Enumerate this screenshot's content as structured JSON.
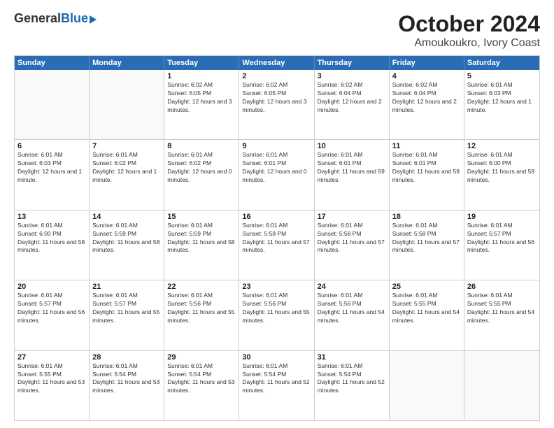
{
  "logo": {
    "general": "General",
    "blue": "Blue"
  },
  "title": "October 2024",
  "location": "Amoukoukro, Ivory Coast",
  "header": {
    "days": [
      "Sunday",
      "Monday",
      "Tuesday",
      "Wednesday",
      "Thursday",
      "Friday",
      "Saturday"
    ]
  },
  "weeks": [
    [
      {
        "day": "",
        "info": ""
      },
      {
        "day": "",
        "info": ""
      },
      {
        "day": "1",
        "info": "Sunrise: 6:02 AM\nSunset: 6:05 PM\nDaylight: 12 hours and 3 minutes."
      },
      {
        "day": "2",
        "info": "Sunrise: 6:02 AM\nSunset: 6:05 PM\nDaylight: 12 hours and 3 minutes."
      },
      {
        "day": "3",
        "info": "Sunrise: 6:02 AM\nSunset: 6:04 PM\nDaylight: 12 hours and 2 minutes."
      },
      {
        "day": "4",
        "info": "Sunrise: 6:02 AM\nSunset: 6:04 PM\nDaylight: 12 hours and 2 minutes."
      },
      {
        "day": "5",
        "info": "Sunrise: 6:01 AM\nSunset: 6:03 PM\nDaylight: 12 hours and 1 minute."
      }
    ],
    [
      {
        "day": "6",
        "info": "Sunrise: 6:01 AM\nSunset: 6:03 PM\nDaylight: 12 hours and 1 minute."
      },
      {
        "day": "7",
        "info": "Sunrise: 6:01 AM\nSunset: 6:02 PM\nDaylight: 12 hours and 1 minute."
      },
      {
        "day": "8",
        "info": "Sunrise: 6:01 AM\nSunset: 6:02 PM\nDaylight: 12 hours and 0 minutes."
      },
      {
        "day": "9",
        "info": "Sunrise: 6:01 AM\nSunset: 6:01 PM\nDaylight: 12 hours and 0 minutes."
      },
      {
        "day": "10",
        "info": "Sunrise: 6:01 AM\nSunset: 6:01 PM\nDaylight: 11 hours and 59 minutes."
      },
      {
        "day": "11",
        "info": "Sunrise: 6:01 AM\nSunset: 6:01 PM\nDaylight: 11 hours and 59 minutes."
      },
      {
        "day": "12",
        "info": "Sunrise: 6:01 AM\nSunset: 6:00 PM\nDaylight: 11 hours and 59 minutes."
      }
    ],
    [
      {
        "day": "13",
        "info": "Sunrise: 6:01 AM\nSunset: 6:00 PM\nDaylight: 11 hours and 58 minutes."
      },
      {
        "day": "14",
        "info": "Sunrise: 6:01 AM\nSunset: 5:59 PM\nDaylight: 11 hours and 58 minutes."
      },
      {
        "day": "15",
        "info": "Sunrise: 6:01 AM\nSunset: 5:59 PM\nDaylight: 11 hours and 58 minutes."
      },
      {
        "day": "16",
        "info": "Sunrise: 6:01 AM\nSunset: 5:58 PM\nDaylight: 11 hours and 57 minutes."
      },
      {
        "day": "17",
        "info": "Sunrise: 6:01 AM\nSunset: 5:58 PM\nDaylight: 11 hours and 57 minutes."
      },
      {
        "day": "18",
        "info": "Sunrise: 6:01 AM\nSunset: 5:58 PM\nDaylight: 11 hours and 57 minutes."
      },
      {
        "day": "19",
        "info": "Sunrise: 6:01 AM\nSunset: 5:57 PM\nDaylight: 11 hours and 56 minutes."
      }
    ],
    [
      {
        "day": "20",
        "info": "Sunrise: 6:01 AM\nSunset: 5:57 PM\nDaylight: 11 hours and 56 minutes."
      },
      {
        "day": "21",
        "info": "Sunrise: 6:01 AM\nSunset: 5:57 PM\nDaylight: 11 hours and 55 minutes."
      },
      {
        "day": "22",
        "info": "Sunrise: 6:01 AM\nSunset: 5:56 PM\nDaylight: 11 hours and 55 minutes."
      },
      {
        "day": "23",
        "info": "Sunrise: 6:01 AM\nSunset: 5:56 PM\nDaylight: 11 hours and 55 minutes."
      },
      {
        "day": "24",
        "info": "Sunrise: 6:01 AM\nSunset: 5:56 PM\nDaylight: 11 hours and 54 minutes."
      },
      {
        "day": "25",
        "info": "Sunrise: 6:01 AM\nSunset: 5:55 PM\nDaylight: 11 hours and 54 minutes."
      },
      {
        "day": "26",
        "info": "Sunrise: 6:01 AM\nSunset: 5:55 PM\nDaylight: 11 hours and 54 minutes."
      }
    ],
    [
      {
        "day": "27",
        "info": "Sunrise: 6:01 AM\nSunset: 5:55 PM\nDaylight: 11 hours and 53 minutes."
      },
      {
        "day": "28",
        "info": "Sunrise: 6:01 AM\nSunset: 5:54 PM\nDaylight: 11 hours and 53 minutes."
      },
      {
        "day": "29",
        "info": "Sunrise: 6:01 AM\nSunset: 5:54 PM\nDaylight: 11 hours and 53 minutes."
      },
      {
        "day": "30",
        "info": "Sunrise: 6:01 AM\nSunset: 5:54 PM\nDaylight: 11 hours and 52 minutes."
      },
      {
        "day": "31",
        "info": "Sunrise: 6:01 AM\nSunset: 5:54 PM\nDaylight: 11 hours and 52 minutes."
      },
      {
        "day": "",
        "info": ""
      },
      {
        "day": "",
        "info": ""
      }
    ]
  ]
}
